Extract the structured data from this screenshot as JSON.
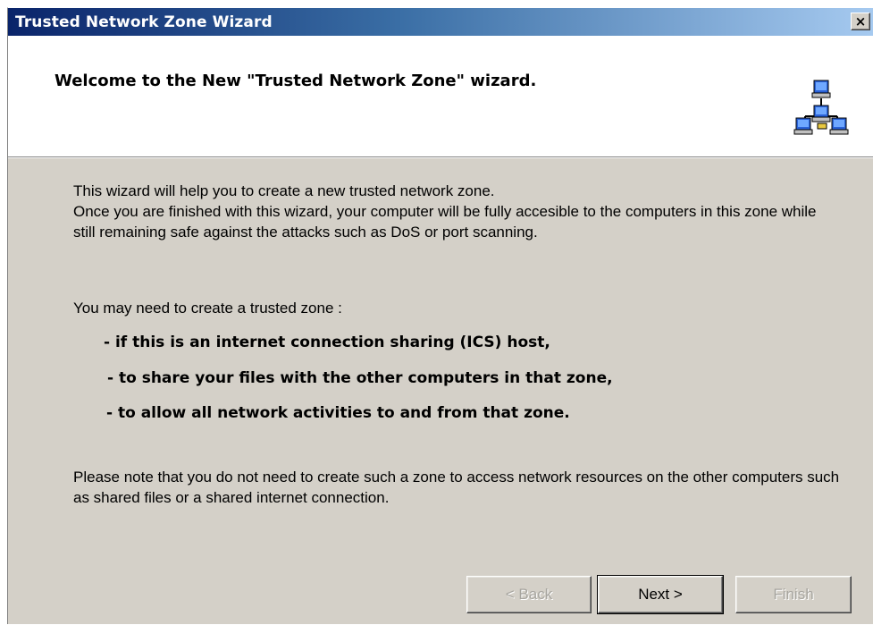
{
  "window": {
    "title": "Trusted Network Zone Wizard",
    "close_label": "×"
  },
  "header": {
    "title": "Welcome to the New \"Trusted Network Zone\" wizard.",
    "icon": "network-computers-icon"
  },
  "body": {
    "intro_lines": [
      "This wizard will help you to create a new trusted network zone.",
      "Once you are finished with this wizard, your computer will be fully accesible to the computers in this zone while still remaining safe against the attacks such as DoS or port scanning."
    ],
    "lead": "You may need to create a trusted zone :",
    "bullets": [
      "- if this is an internet connection sharing (ICS) host,",
      "- to share your files with the other computers in that zone,",
      "- to allow all network activities to and from that zone."
    ],
    "note": "Please note that you do not need to create such a zone to access network resources on the other computers such as shared files or a shared internet connection."
  },
  "buttons": {
    "back": {
      "label": "< Back",
      "enabled": false
    },
    "next": {
      "label": "Next >",
      "enabled": true
    },
    "finish": {
      "label": "Finish",
      "enabled": false
    }
  }
}
